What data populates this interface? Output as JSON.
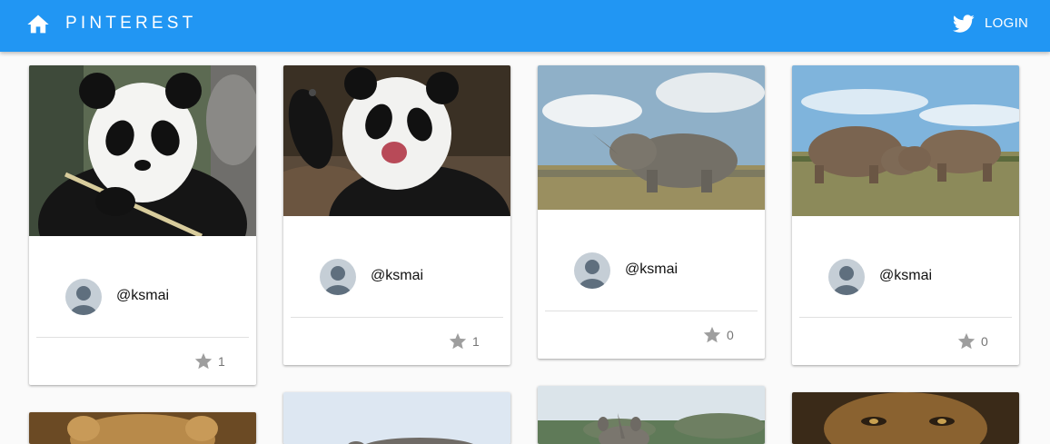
{
  "header": {
    "title": "PINTEREST",
    "home_icon": "home-icon",
    "twitter_icon": "twitter-icon",
    "login_label": "LOGIN",
    "background_color": "#2196f3"
  },
  "cards": [
    {
      "image": "panda eating bamboo",
      "author": "@ksmai",
      "likes": "1",
      "star_icon": "star-icon"
    },
    {
      "image": "panda waving",
      "author": "@ksmai",
      "likes": "1",
      "star_icon": "star-icon"
    },
    {
      "image": "rhinoceros in grassland",
      "author": "@ksmai",
      "likes": "0",
      "star_icon": "star-icon"
    },
    {
      "image": "two rhinoceroses",
      "author": "@ksmai",
      "likes": "0",
      "star_icon": "star-icon"
    }
  ],
  "colors": {
    "accent": "#2196f3",
    "star": "#9e9e9e",
    "avatar_bg": "#c5ced6",
    "avatar_fg": "#5f6f7e"
  }
}
